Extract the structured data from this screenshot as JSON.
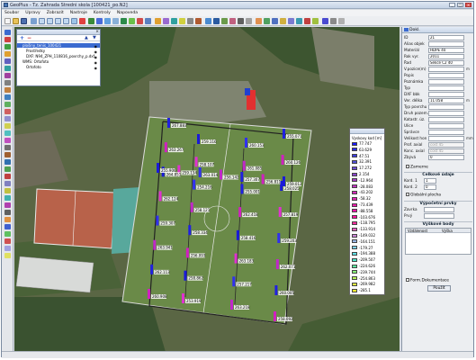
{
  "window": {
    "title": "GeoPlus - Tz. Zahrada Stredni skola  [100421_po.N2]",
    "buttons": [
      "_",
      "□",
      "×"
    ]
  },
  "menu": [
    "Soubor",
    "Upravy",
    "Zobrazit",
    "Nastroje",
    "Kontroly",
    "Napoveda"
  ],
  "layers_panel": {
    "items": [
      "plošiny_tenis_100421",
      "Prostředky",
      "DXF: N94_ZPH_110816_povrchy_p.dxf",
      "WMS: Ortofoto",
      "Ortofoto"
    ]
  },
  "properties_panel": {
    "header": "Dokl.",
    "fields": [
      {
        "label": "ID",
        "value": "21",
        "unit": ""
      },
      {
        "label": "Alias objek",
        "value": "",
        "unit": ""
      },
      {
        "label": "Materiál",
        "value": "HDPE 40",
        "unit": ""
      },
      {
        "label": "Rok vyr.",
        "value": "2011",
        "unit": ""
      },
      {
        "label": "Řad",
        "value": "Sekce C2 40",
        "unit": ""
      },
      {
        "label": "V.pozice(m)",
        "value": "",
        "unit": "m"
      },
      {
        "label": "Popis",
        "value": "",
        "unit": ""
      },
      {
        "label": "Poznámka",
        "value": "",
        "unit": ""
      },
      {
        "label": "Typ",
        "value": "",
        "unit": ""
      },
      {
        "label": "DXF bbk",
        "value": "",
        "unit": ""
      },
      {
        "label": "Ver. délka",
        "value": "11.058",
        "unit": "m"
      },
      {
        "label": "Typ povrchu",
        "value": "",
        "unit": ""
      },
      {
        "label": "Druh pozem.",
        "value": "",
        "unit": ""
      },
      {
        "label": "Katastr. úz.",
        "value": "",
        "unit": ""
      },
      {
        "label": "Ulice",
        "value": "",
        "unit": ""
      },
      {
        "label": "Správce",
        "value": "",
        "unit": ""
      },
      {
        "label": "Velikost hon",
        "value": "",
        "unit": "mm"
      },
      {
        "label": "Prof. axial",
        "value": "cost 45",
        "unit": ""
      },
      {
        "label": "Konc. axial",
        "value": "cost 45",
        "unit": ""
      },
      {
        "label": "Zbývá",
        "value": "0",
        "unit": ""
      }
    ],
    "zamerne_label": "Zamerne",
    "section_total": "Celkové údaje",
    "coord_fields": [
      {
        "label": "Kord. 1",
        "value": "1"
      },
      {
        "label": "Kord. 2",
        "value": "0"
      }
    ],
    "globalni_label": "Globální plocha",
    "section_vypocty": "Výpočetní prvky",
    "calc_fields": [
      {
        "label": "Zavrka",
        "value": ""
      },
      {
        "label": "Prvý",
        "value": ""
      }
    ],
    "section_body": "Výškové body",
    "table_headers": [
      "Vzdálenost",
      "Výška"
    ],
    "footer_check": "Form.Dokumentace",
    "apply_button": "Použít"
  },
  "legend": {
    "title": "Vyskovy kod [m]",
    "entries": [
      {
        "label": "77.747",
        "color": "#1a1aff"
      },
      {
        "label": "63.629",
        "color": "#2a2af0"
      },
      {
        "label": "47.51",
        "color": "#3c3ce0"
      },
      {
        "label": "32.391",
        "color": "#5050d8"
      },
      {
        "label": "17.272",
        "color": "#6a4ad2"
      },
      {
        "label": "2.154",
        "color": "#8a44cc"
      },
      {
        "label": "-12.964",
        "color": "#a63cc6"
      },
      {
        "label": "-28.083",
        "color": "#c034c0"
      },
      {
        "label": "-43.202",
        "color": "#d42cba"
      },
      {
        "label": "-58.32",
        "color": "#e224b4"
      },
      {
        "label": "-73.439",
        "color": "#ee1cae"
      },
      {
        "label": "-88.558",
        "color": "#f514a8"
      },
      {
        "label": "-103.676",
        "color": "#ff10a2"
      },
      {
        "label": "-118.795",
        "color": "#ff2a9c"
      },
      {
        "label": "-133.914",
        "color": "#f05cc0"
      },
      {
        "label": "-149.032",
        "color": "#cc88d8"
      },
      {
        "label": "-164.151",
        "color": "#9ab8e6"
      },
      {
        "label": "-179.27",
        "color": "#7ad0ee"
      },
      {
        "label": "-194.388",
        "color": "#60e0e6"
      },
      {
        "label": "-209.507",
        "color": "#4ce8c8"
      },
      {
        "label": "-224.626",
        "color": "#5cf0a0"
      },
      {
        "label": "-239.744",
        "color": "#88f47a"
      },
      {
        "label": "-254.863",
        "color": "#b8f45a"
      },
      {
        "label": "-269.982",
        "color": "#e0f040"
      },
      {
        "label": "-285.1",
        "color": "#ffee30"
      }
    ]
  },
  "map_labels": [
    "267.883",
    "263.267",
    "264.851",
    "262.124",
    "259.307",
    "263.941",
    "262.113",
    "260.908",
    "259.116",
    "258.107",
    "254.216",
    "258.121",
    "258.334",
    "256.093",
    "258.862",
    "253.919",
    "260.153",
    "261.085",
    "255.001",
    "262.418",
    "258.416",
    "263.183",
    "257.217",
    "263.218",
    "255.071",
    "260.126",
    "258.025",
    "257.819",
    "259.203",
    "262.071",
    "260.005",
    "258.092",
    "255.906",
    "259.134",
    "263.014",
    "256.142",
    "257.307",
    "256.811",
    "259.012"
  ]
}
